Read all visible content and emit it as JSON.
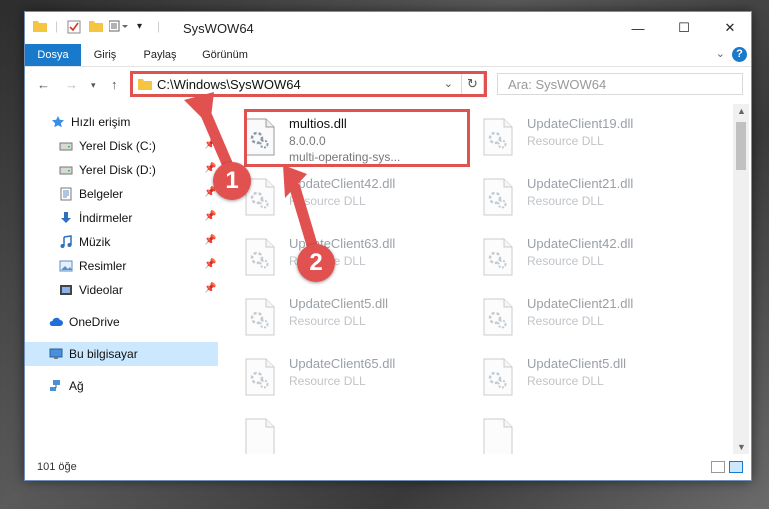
{
  "window": {
    "title": "SysWOW64",
    "controls": {
      "minimize": "—",
      "maximize": "☐",
      "close": "✕"
    }
  },
  "ribbon": {
    "tabs": [
      "Dosya",
      "Giriş",
      "Paylaş",
      "Görünüm"
    ],
    "active_tab": "Dosya",
    "help": "?"
  },
  "navigation": {
    "address": "C:\\Windows\\SysWOW64",
    "search_placeholder": "Ara: SysWOW64"
  },
  "sidebar": {
    "items": [
      {
        "label": "Hızlı erişim",
        "icon": "star-icon",
        "pinned": false
      },
      {
        "label": "Yerel Disk (C:)",
        "icon": "drive-icon",
        "pinned": true
      },
      {
        "label": "Yerel Disk (D:)",
        "icon": "drive-icon",
        "pinned": true
      },
      {
        "label": "Belgeler",
        "icon": "documents-icon",
        "pinned": true
      },
      {
        "label": "İndirmeler",
        "icon": "download-icon",
        "pinned": true
      },
      {
        "label": "Müzik",
        "icon": "music-icon",
        "pinned": true
      },
      {
        "label": "Resimler",
        "icon": "pictures-icon",
        "pinned": true
      },
      {
        "label": "Videolar",
        "icon": "video-icon",
        "pinned": true
      },
      {
        "label": "OneDrive",
        "icon": "cloud-icon",
        "pinned": false
      },
      {
        "label": "Bu bilgisayar",
        "icon": "computer-icon",
        "pinned": false
      },
      {
        "label": "Ağ",
        "icon": "network-icon",
        "pinned": false
      }
    ],
    "selected": "Bu bilgisayar"
  },
  "files": [
    {
      "name": "multios.dll",
      "line2": "8.0.0.0",
      "line3": "multi-operating-sys...",
      "highlighted": true
    },
    {
      "name": "UpdateClient19.dll",
      "line2": "Resource DLL"
    },
    {
      "name": "UpdateClient42.dll",
      "line2": "Resource DLL"
    },
    {
      "name": "UpdateClient21.dll",
      "line2": "Resource DLL"
    },
    {
      "name": "UpdateClient63.dll",
      "line2": "Resource DLL"
    },
    {
      "name": "UpdateClient42.dll",
      "line2": "Resource DLL"
    },
    {
      "name": "UpdateClient5.dll",
      "line2": "Resource DLL"
    },
    {
      "name": "UpdateClient21.dll",
      "line2": "Resource DLL"
    },
    {
      "name": "UpdateClient65.dll",
      "line2": "Resource DLL"
    },
    {
      "name": "UpdateClient5.dll",
      "line2": "Resource DLL"
    }
  ],
  "status": {
    "item_count": "101 öğe"
  },
  "annotations": {
    "step1": "1",
    "step2": "2",
    "color": "#e0514f"
  },
  "colors": {
    "accent": "#1979ca",
    "selection": "#cce8ff"
  }
}
